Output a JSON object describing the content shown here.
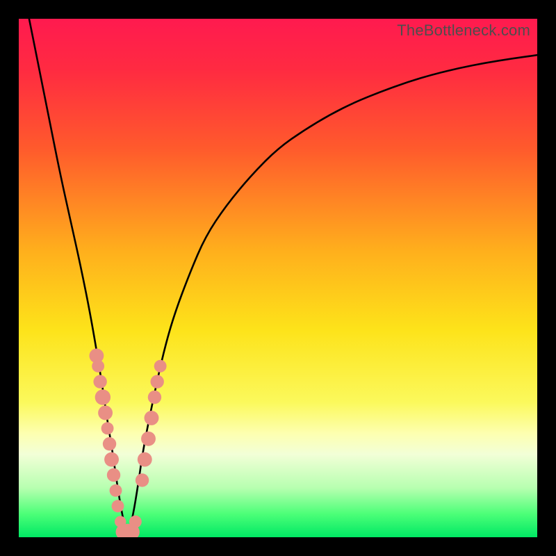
{
  "watermark": "TheBottleneck.com",
  "chart_data": {
    "type": "line",
    "title": "",
    "xlabel": "",
    "ylabel": "",
    "xlim": [
      0,
      100
    ],
    "ylim": [
      0,
      100
    ],
    "grid": false,
    "legend": false,
    "optimum_x": 21,
    "gradient_stops": [
      {
        "pos": 0.0,
        "color": "#ff1a4f"
      },
      {
        "pos": 0.1,
        "color": "#ff2b41"
      },
      {
        "pos": 0.25,
        "color": "#ff5a2c"
      },
      {
        "pos": 0.45,
        "color": "#ffb01c"
      },
      {
        "pos": 0.6,
        "color": "#fde31a"
      },
      {
        "pos": 0.74,
        "color": "#fbf95c"
      },
      {
        "pos": 0.8,
        "color": "#fdffb0"
      },
      {
        "pos": 0.84,
        "color": "#f2ffd7"
      },
      {
        "pos": 0.905,
        "color": "#b7ffb0"
      },
      {
        "pos": 0.955,
        "color": "#4cff78"
      },
      {
        "pos": 1.0,
        "color": "#00e864"
      }
    ],
    "series": [
      {
        "name": "bottleneck-curve",
        "x": [
          2,
          4,
          6,
          8,
          10,
          12,
          14,
          16,
          17,
          18,
          19,
          20,
          21,
          22,
          23,
          24,
          26,
          28,
          30,
          33,
          36,
          40,
          45,
          50,
          55,
          60,
          65,
          70,
          75,
          80,
          85,
          90,
          95,
          100
        ],
        "y": [
          100,
          90,
          80,
          70,
          61,
          52,
          42,
          30,
          23,
          17,
          10,
          4,
          0,
          4,
          10,
          17,
          27,
          36,
          43,
          51,
          58,
          64,
          70,
          75,
          78.5,
          81.5,
          84,
          86,
          87.8,
          89.3,
          90.5,
          91.5,
          92.3,
          93
        ]
      }
    ],
    "markers": {
      "name": "highlight-dots",
      "color": "#e98f85",
      "points": [
        {
          "x": 15.0,
          "y": 35,
          "r": 1.4
        },
        {
          "x": 15.3,
          "y": 33,
          "r": 1.2
        },
        {
          "x": 15.7,
          "y": 30,
          "r": 1.3
        },
        {
          "x": 16.2,
          "y": 27,
          "r": 1.5
        },
        {
          "x": 16.7,
          "y": 24,
          "r": 1.4
        },
        {
          "x": 17.1,
          "y": 21,
          "r": 1.2
        },
        {
          "x": 17.5,
          "y": 18,
          "r": 1.3
        },
        {
          "x": 17.9,
          "y": 15,
          "r": 1.4
        },
        {
          "x": 18.3,
          "y": 12,
          "r": 1.3
        },
        {
          "x": 18.7,
          "y": 9,
          "r": 1.2
        },
        {
          "x": 19.1,
          "y": 6,
          "r": 1.2
        },
        {
          "x": 19.6,
          "y": 3,
          "r": 1.1
        },
        {
          "x": 20.2,
          "y": 1,
          "r": 1.5
        },
        {
          "x": 21.0,
          "y": 1,
          "r": 1.6
        },
        {
          "x": 21.8,
          "y": 1,
          "r": 1.5
        },
        {
          "x": 22.5,
          "y": 3,
          "r": 1.2
        },
        {
          "x": 23.8,
          "y": 11,
          "r": 1.3
        },
        {
          "x": 24.3,
          "y": 15,
          "r": 1.4
        },
        {
          "x": 25.0,
          "y": 19,
          "r": 1.4
        },
        {
          "x": 25.6,
          "y": 23,
          "r": 1.4
        },
        {
          "x": 26.2,
          "y": 27,
          "r": 1.3
        },
        {
          "x": 26.7,
          "y": 30,
          "r": 1.3
        },
        {
          "x": 27.3,
          "y": 33,
          "r": 1.2
        }
      ]
    }
  }
}
